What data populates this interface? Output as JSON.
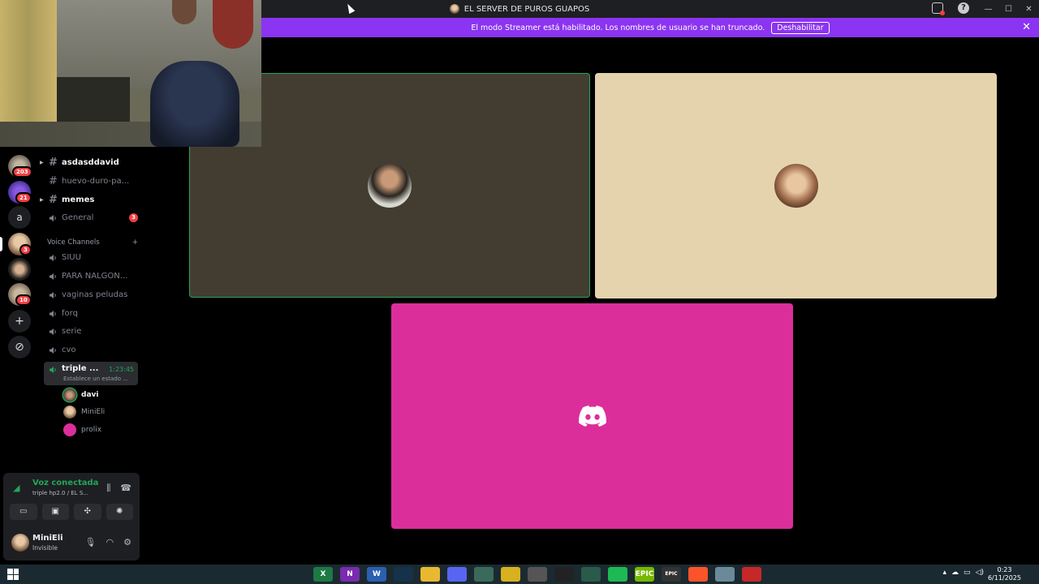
{
  "window": {
    "title": "EL SERVER DE PUROS GUAPOS",
    "help_glyph": "?",
    "controls": [
      "—",
      "☐",
      "✕"
    ]
  },
  "banner": {
    "message": "El modo Streamer está habilitado. Los nombres de usuario se han truncado.",
    "button_label": "Deshabilitar",
    "close_glyph": "✕"
  },
  "servers": {
    "badges": [
      "203",
      "21",
      "3",
      "10"
    ],
    "letter": "a",
    "add_glyph": "+",
    "explore_glyph": "⊘"
  },
  "channels": {
    "text_channels": [
      {
        "name": "asdasddavid",
        "bold": true
      },
      {
        "name": "huevo-duro-pa...",
        "bold": false
      },
      {
        "name": "memes",
        "bold": true
      }
    ],
    "general": {
      "name": "General",
      "mentions": "3"
    },
    "category": "Voice Channels",
    "category_add": "+",
    "voice_channels": [
      "SIUU",
      "PARA NALGON...",
      "vaginas peludas",
      "forq",
      "serie",
      "cvo"
    ],
    "active_channel": {
      "name": "triple ...",
      "timer": "1:23:45",
      "status": "Establece un estado ..."
    },
    "voice_users": [
      "davi",
      "MiniEli",
      "prolix"
    ]
  },
  "voice_panel": {
    "status": "Voz conectada",
    "subtitle": "triple hp2.0 / EL S...",
    "user_name": "MiniEli",
    "user_status": "Invisible"
  },
  "taskbar": {
    "clock_time": "0:23",
    "clock_date": "6/11/2025",
    "apps": [
      "X",
      "N",
      "W",
      "",
      "",
      "",
      "",
      "",
      "",
      "",
      "",
      "",
      "EPIC",
      "",
      "",
      ""
    ]
  },
  "colors": {
    "streamer_banner": "#8b34f1",
    "speaking_ring": "#23a559",
    "tile_3": "#dc2e9b",
    "tile_2": "#e5d3ae",
    "tile_1": "#433d31"
  }
}
